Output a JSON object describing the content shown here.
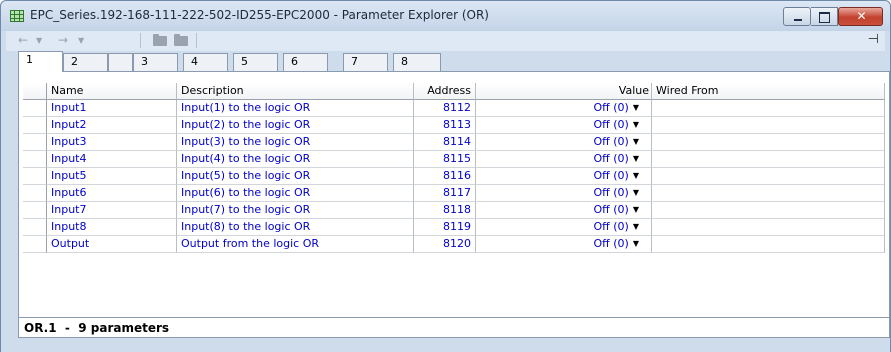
{
  "window": {
    "title": "EPC_Series.192-168-111-222-502-ID255-EPC2000 - Parameter Explorer (OR)"
  },
  "toolbar": {
    "back_icon": "←",
    "forward_icon": "→",
    "dropdown_icon": "▼",
    "pin_icon": "⊣"
  },
  "tabs": [
    "1",
    "2",
    "3",
    "4",
    "5",
    "6",
    "7",
    "8"
  ],
  "table": {
    "headers": {
      "name": "Name",
      "description": "Description",
      "address": "Address",
      "value": "Value",
      "wired_from": "Wired From"
    },
    "rows": [
      {
        "name": "Input1",
        "description": "Input(1) to the logic OR",
        "address": "8112",
        "value": "Off (0)",
        "wired_from": ""
      },
      {
        "name": "Input2",
        "description": "Input(2) to the logic OR",
        "address": "8113",
        "value": "Off (0)",
        "wired_from": ""
      },
      {
        "name": "Input3",
        "description": "Input(3) to the logic OR",
        "address": "8114",
        "value": "Off (0)",
        "wired_from": ""
      },
      {
        "name": "Input4",
        "description": "Input(4) to the logic OR",
        "address": "8115",
        "value": "Off (0)",
        "wired_from": ""
      },
      {
        "name": "Input5",
        "description": "Input(5) to the logic OR",
        "address": "8116",
        "value": "Off (0)",
        "wired_from": ""
      },
      {
        "name": "Input6",
        "description": "Input(6) to the logic OR",
        "address": "8117",
        "value": "Off (0)",
        "wired_from": ""
      },
      {
        "name": "Input7",
        "description": "Input(7) to the logic OR",
        "address": "8118",
        "value": "Off (0)",
        "wired_from": ""
      },
      {
        "name": "Input8",
        "description": "Input(8) to the logic OR",
        "address": "8119",
        "value": "Off (0)",
        "wired_from": ""
      },
      {
        "name": "Output",
        "description": "Output from the logic OR",
        "address": "8120",
        "value": "Off (0)",
        "wired_from": ""
      }
    ]
  },
  "status": {
    "text": "OR.1  -  9 parameters"
  }
}
